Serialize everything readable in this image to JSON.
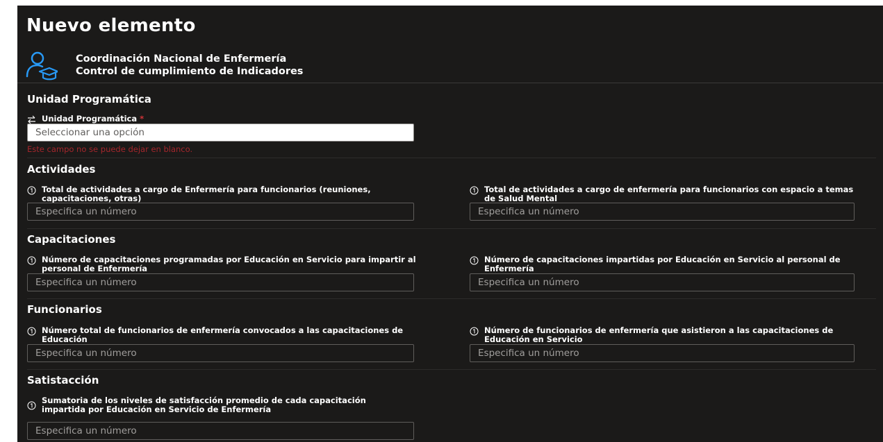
{
  "page": {
    "title": "Nuevo elemento"
  },
  "header": {
    "org_line1": "Coordinación Nacional de Enfermería",
    "org_line2": "Control de cumplimiento de Indicadores",
    "icon": "person-graduation-icon",
    "accent_color": "#2899f5"
  },
  "sections": {
    "unidad": {
      "heading": "Unidad Programática",
      "field_label": "Unidad Programática",
      "required_mark": "*",
      "placeholder": "Seleccionar una opción",
      "error": "Este campo no se puede dejar en blanco.",
      "icon": "lookup-arrows-icon"
    },
    "actividades": {
      "heading": "Actividades",
      "field1_label": "Total de actividades a cargo de Enfermería para funcionarios (reuniones, capacitaciones, otras)",
      "field1_placeholder": "Especifica un número",
      "field2_label": "Total de actividades a cargo de enfermería para funcionarios con espacio a temas de Salud Mental",
      "field2_placeholder": "Especifica un número"
    },
    "capacitaciones": {
      "heading": "Capacitaciones",
      "field1_label": "Número de capacitaciones programadas por Educación en Servicio para impartir al personal de Enfermería",
      "field1_placeholder": "Especifica un número",
      "field2_label": "Número de capacitaciones impartidas por Educación en Servicio al personal de Enfermería",
      "field2_placeholder": "Especifica un número"
    },
    "funcionarios": {
      "heading": "Funcionarios",
      "field1_label": "Número total de funcionarios de enfermería convocados a las capacitaciones de Educación",
      "field1_placeholder": "Especifica un número",
      "field2_label": "Número de funcionarios de enfermería que asistieron a las capacitaciones de Educación en Servicio",
      "field2_placeholder": "Especifica un número"
    },
    "satisfaccion": {
      "heading": "Satistacción",
      "field1_label": "Sumatoria de los niveles de satisfacción promedio de cada capacitación impartida por Educación en Servicio de Enfermería",
      "field1_placeholder": "Especifica un número"
    }
  },
  "icons": {
    "field_type": "number-symbol-icon"
  }
}
